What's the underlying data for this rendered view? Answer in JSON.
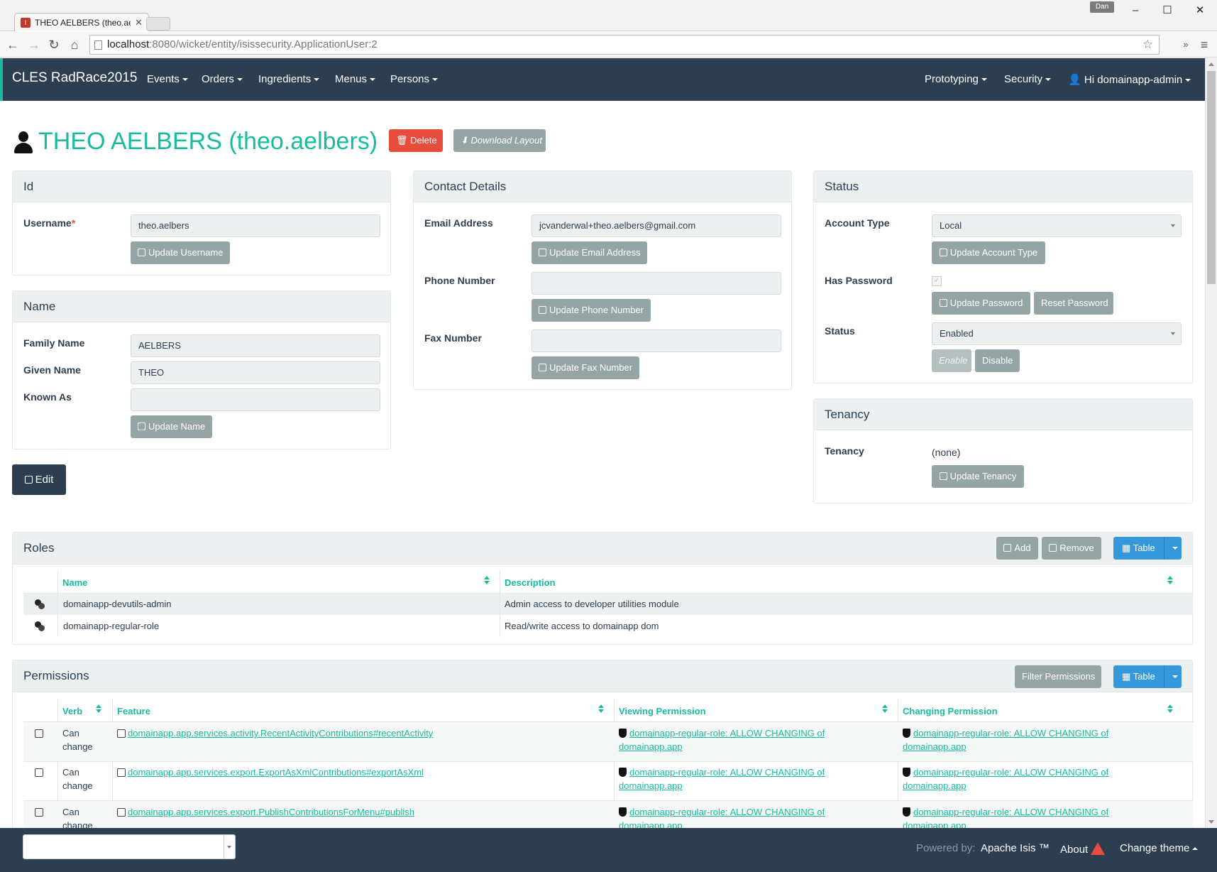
{
  "browser": {
    "tab_title": "THEO AELBERS (theo.aelb",
    "user_badge": "Dan",
    "url_host": "localhost",
    "url_rest": ":8080/wicket/entity/isissecurity.ApplicationUser:2"
  },
  "navbar": {
    "brand": "CLES RadRace2015",
    "menus": [
      "Events",
      "Orders",
      "Ingredients",
      "Menus",
      "Persons"
    ],
    "right": {
      "prototyping": "Prototyping",
      "security": "Security",
      "user": "Hi domainapp-admin"
    }
  },
  "entity": {
    "title": "THEO AELBERS (theo.aelbers)",
    "delete_label": "Delete",
    "download_layout_label": "Download Layout",
    "edit_label": "Edit"
  },
  "id_panel": {
    "title": "Id",
    "username_label": "Username",
    "required_mark": "*",
    "username_value": "theo.aelbers",
    "update_username": "Update Username"
  },
  "name_panel": {
    "title": "Name",
    "family_name_label": "Family Name",
    "family_name_value": "AELBERS",
    "given_name_label": "Given Name",
    "given_name_value": "THEO",
    "known_as_label": "Known As",
    "known_as_value": "",
    "update_name": "Update Name"
  },
  "contact_panel": {
    "title": "Contact Details",
    "email_label": "Email Address",
    "email_value": "jcvanderwal+theo.aelbers@gmail.com",
    "update_email": "Update Email Address",
    "phone_label": "Phone Number",
    "phone_value": "",
    "update_phone": "Update Phone Number",
    "fax_label": "Fax Number",
    "fax_value": "",
    "update_fax": "Update Fax Number"
  },
  "status_panel": {
    "title": "Status",
    "account_type_label": "Account Type",
    "account_type_value": "Local",
    "update_account_type": "Update Account Type",
    "has_password_label": "Has Password",
    "has_password_check": "✓",
    "update_password": "Update Password",
    "reset_password": "Reset Password",
    "status_label": "Status",
    "status_value": "Enabled",
    "enable": "Enable",
    "disable": "Disable"
  },
  "tenancy_panel": {
    "title": "Tenancy",
    "tenancy_label": "Tenancy",
    "tenancy_value": "(none)",
    "update_tenancy": "Update Tenancy"
  },
  "roles": {
    "title": "Roles",
    "add": "Add",
    "remove": "Remove",
    "view": "Table",
    "columns": [
      "Name",
      "Description"
    ],
    "rows": [
      {
        "name": "domainapp-devutils-admin",
        "description": "Admin access to developer utilities module"
      },
      {
        "name": "domainapp-regular-role",
        "description": "Read/write access to domainapp dom"
      }
    ]
  },
  "permissions": {
    "title": "Permissions",
    "filter": "Filter Permissions",
    "view": "Table",
    "columns": [
      "Verb",
      "Feature",
      "Viewing Permission",
      "Changing Permission"
    ],
    "rows": [
      {
        "verb_1": "Can",
        "verb_2": "change",
        "feature": "domainapp.app.services.activity.RecentActivityContributions#recentActivity",
        "viewing_1": "domainapp-regular-role: ALLOW CHANGING of",
        "viewing_2": "domainapp.app",
        "changing_1": "domainapp-regular-role: ALLOW CHANGING of",
        "changing_2": "domainapp.app"
      },
      {
        "verb_1": "Can",
        "verb_2": "change",
        "feature": "domainapp.app.services.export.ExportAsXmlContributions#exportAsXml",
        "viewing_1": "domainapp-regular-role: ALLOW CHANGING of",
        "viewing_2": "domainapp.app",
        "changing_1": "domainapp-regular-role: ALLOW CHANGING of",
        "changing_2": "domainapp.app"
      },
      {
        "verb_1": "Can",
        "verb_2": "change",
        "feature": "domainapp.app.services.export.PublishContributionsForMenu#publish",
        "viewing_1": "domainapp-regular-role: ALLOW CHANGING of",
        "viewing_2": "domainapp.app",
        "changing_1": "domainapp-regular-role: ALLOW CHANGING of",
        "changing_2": "domainapp.app"
      }
    ]
  },
  "footer": {
    "powered_by": "Powered by:",
    "apache_isis": "Apache Isis ™",
    "about": "About",
    "change_theme": "Change theme"
  }
}
